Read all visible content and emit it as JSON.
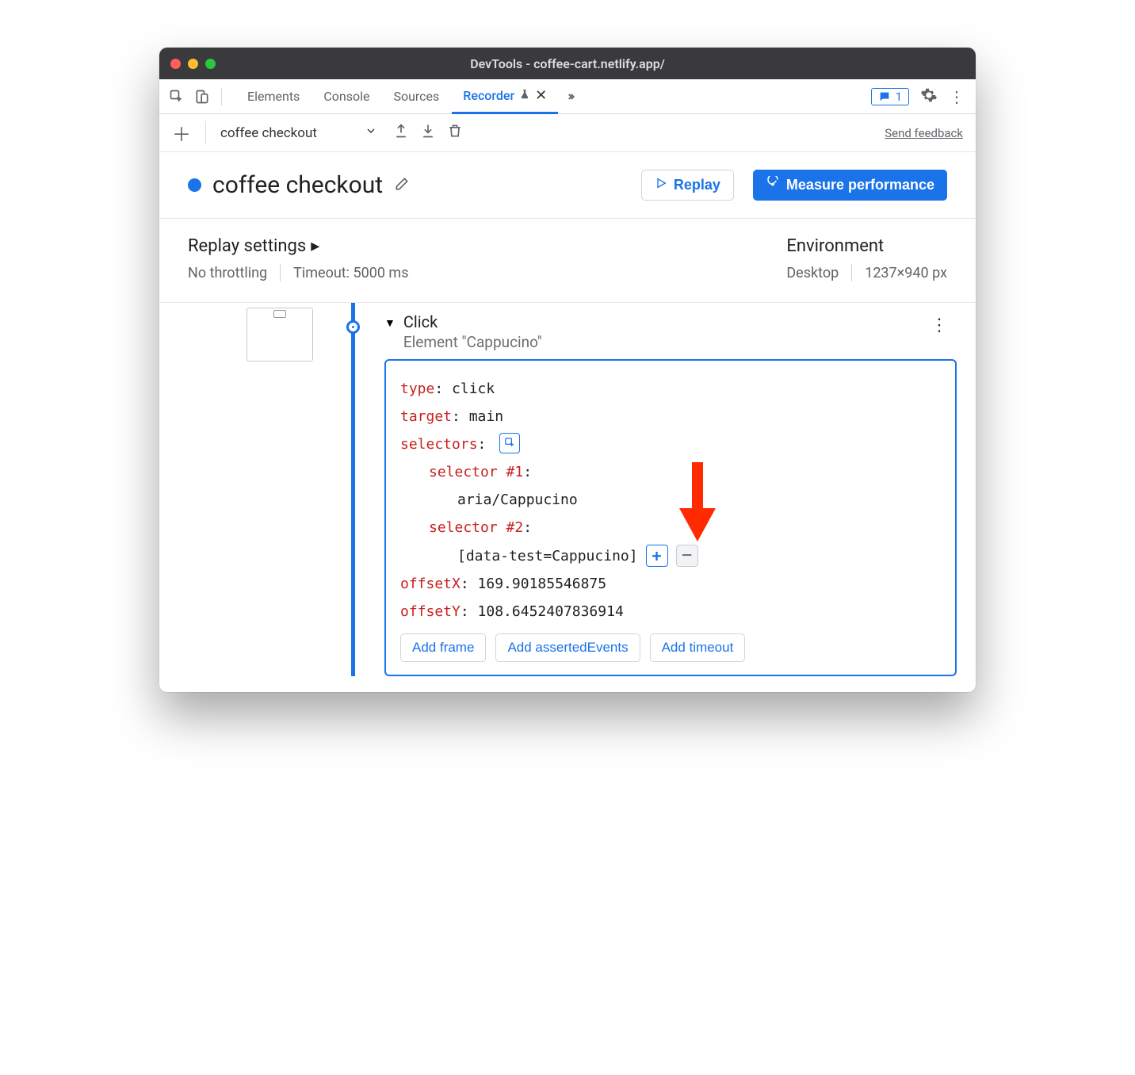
{
  "window": {
    "title": "DevTools - coffee-cart.netlify.app/"
  },
  "tabs": {
    "items": [
      "Elements",
      "Console",
      "Sources",
      "Recorder"
    ],
    "active": "Recorder",
    "feedback_count": "1"
  },
  "toolbar": {
    "recording_name": "coffee checkout",
    "feedback_link": "Send feedback"
  },
  "header": {
    "title": "coffee checkout",
    "replay_btn": "Replay",
    "measure_btn": "Measure performance"
  },
  "settings": {
    "replay_title": "Replay settings",
    "throttling": "No throttling",
    "timeout": "Timeout: 5000 ms",
    "env_title": "Environment",
    "device": "Desktop",
    "viewport": "1237×940 px"
  },
  "step": {
    "title": "Click",
    "subtitle": "Element \"Cappucino\"",
    "type_key": "type",
    "type_val": "click",
    "target_key": "target",
    "target_val": "main",
    "selectors_key": "selectors",
    "sel1_key": "selector #1",
    "sel1_val": "aria/Cappucino",
    "sel2_key": "selector #2",
    "sel2_val": "[data-test=Cappucino]",
    "offsetx_key": "offsetX",
    "offsetx_val": "169.90185546875",
    "offsety_key": "offsetY",
    "offsety_val": "108.6452407836914",
    "actions": {
      "add_frame": "Add frame",
      "add_asserted": "Add assertedEvents",
      "add_timeout": "Add timeout"
    }
  }
}
